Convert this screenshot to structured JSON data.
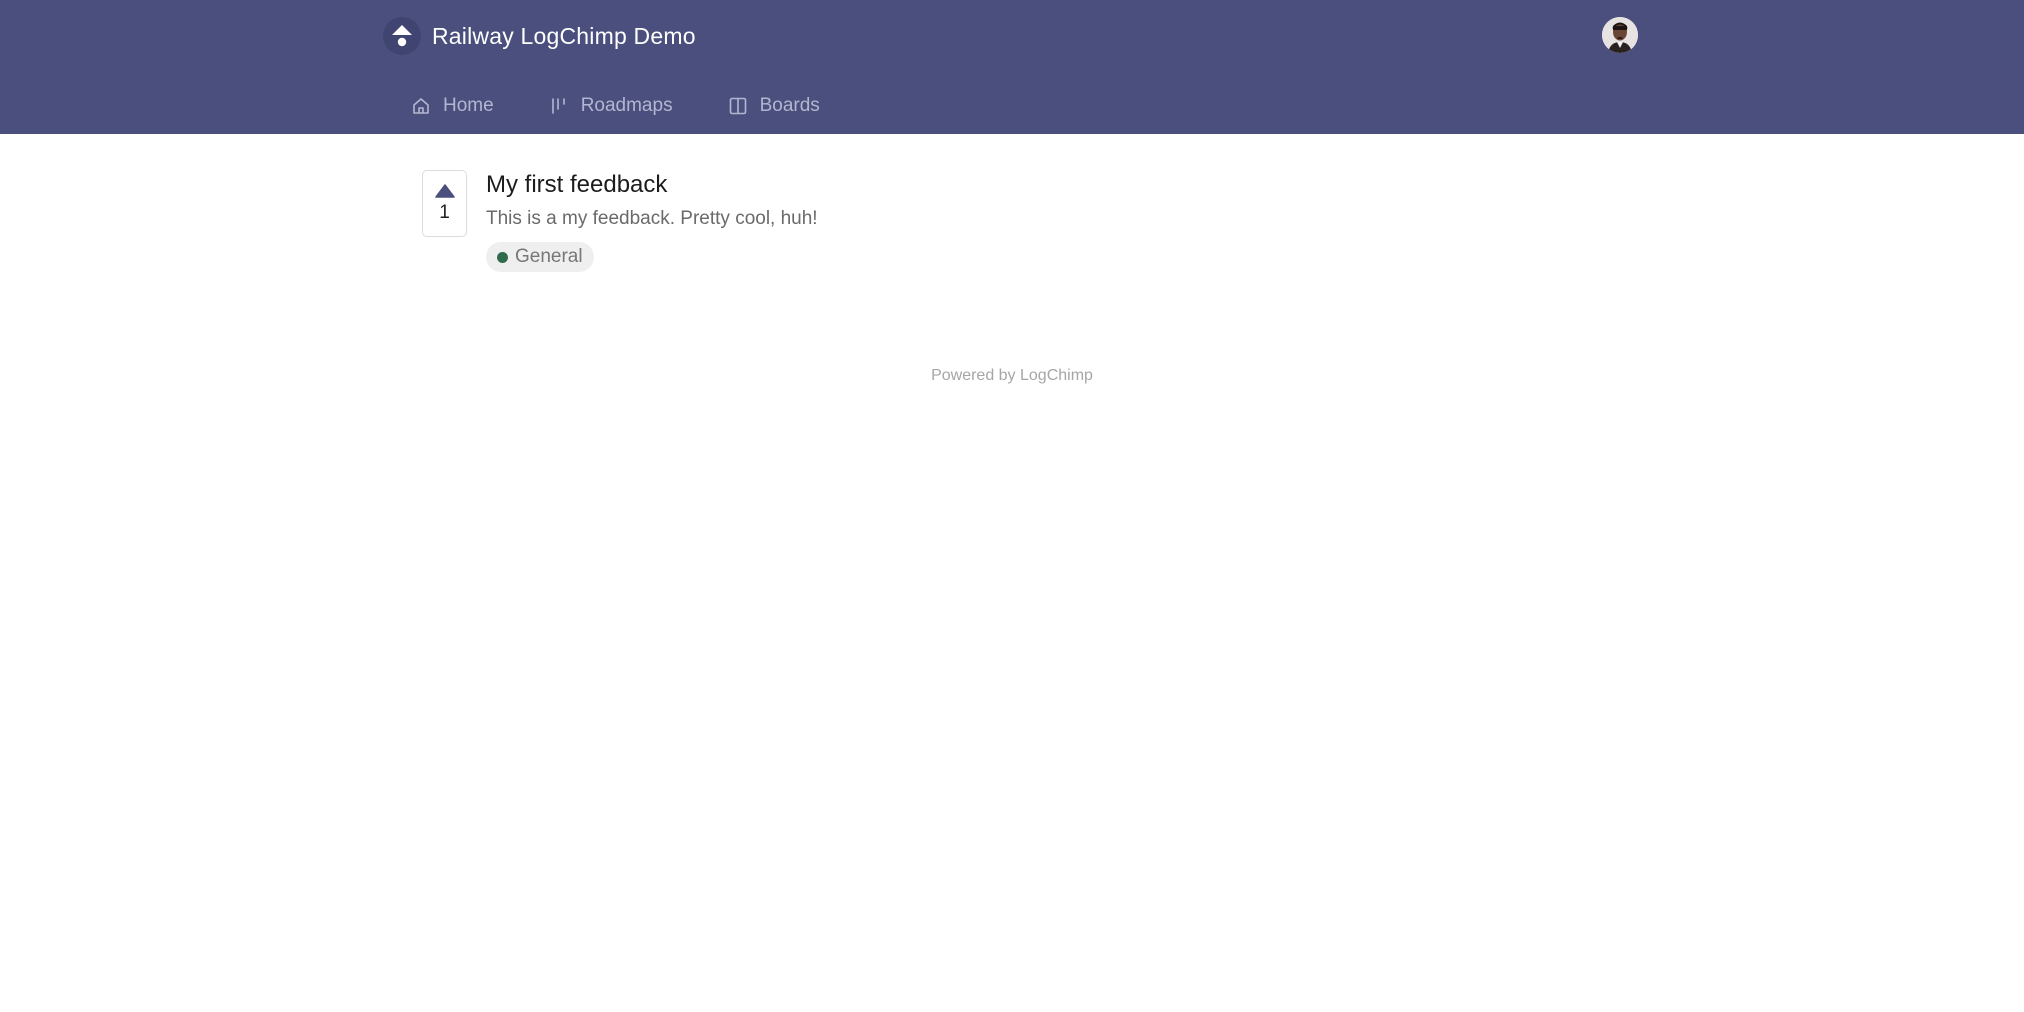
{
  "header": {
    "brand_title": "Railway LogChimp Demo",
    "logo_icon": "logchimp-logo-icon",
    "avatar_icon": "user-avatar",
    "background_color": "#4a4f7d"
  },
  "nav": {
    "items": [
      {
        "label": "Home",
        "icon": "home-icon"
      },
      {
        "label": "Roadmaps",
        "icon": "roadmap-icon"
      },
      {
        "label": "Boards",
        "icon": "board-icon"
      }
    ]
  },
  "posts": [
    {
      "title": "My first feedback",
      "description": "This is a my feedback. Pretty cool, huh!",
      "votes": "1",
      "board": {
        "name": "General",
        "color": "#2f6b4c"
      }
    }
  ],
  "footer": {
    "text": "Powered by LogChimp"
  }
}
